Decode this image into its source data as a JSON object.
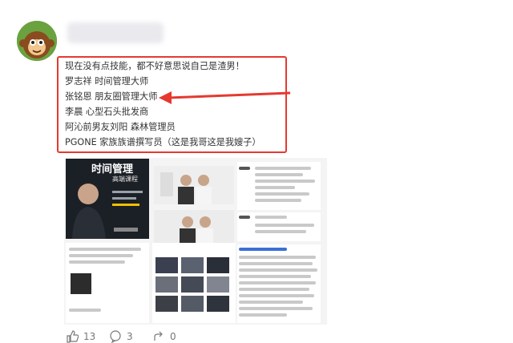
{
  "comment": {
    "lines": [
      "现在没有点技能，都不好意思说自己是渣男！",
      "罗志祥 时间管理大师",
      "张铭恩 朋友圈管理大师",
      "李晨 心型石头批发商",
      "阿沁前男友刘阳 森林管理员",
      "PGONE 家族族谱撰写员（这是我哥这是我嫂子）"
    ]
  },
  "poster": {
    "title": "时间管理",
    "subtitle": "高端课程"
  },
  "footer": {
    "likes": "13",
    "comments": "3",
    "shares": "0"
  },
  "colors": {
    "highlight": "#e53930"
  }
}
